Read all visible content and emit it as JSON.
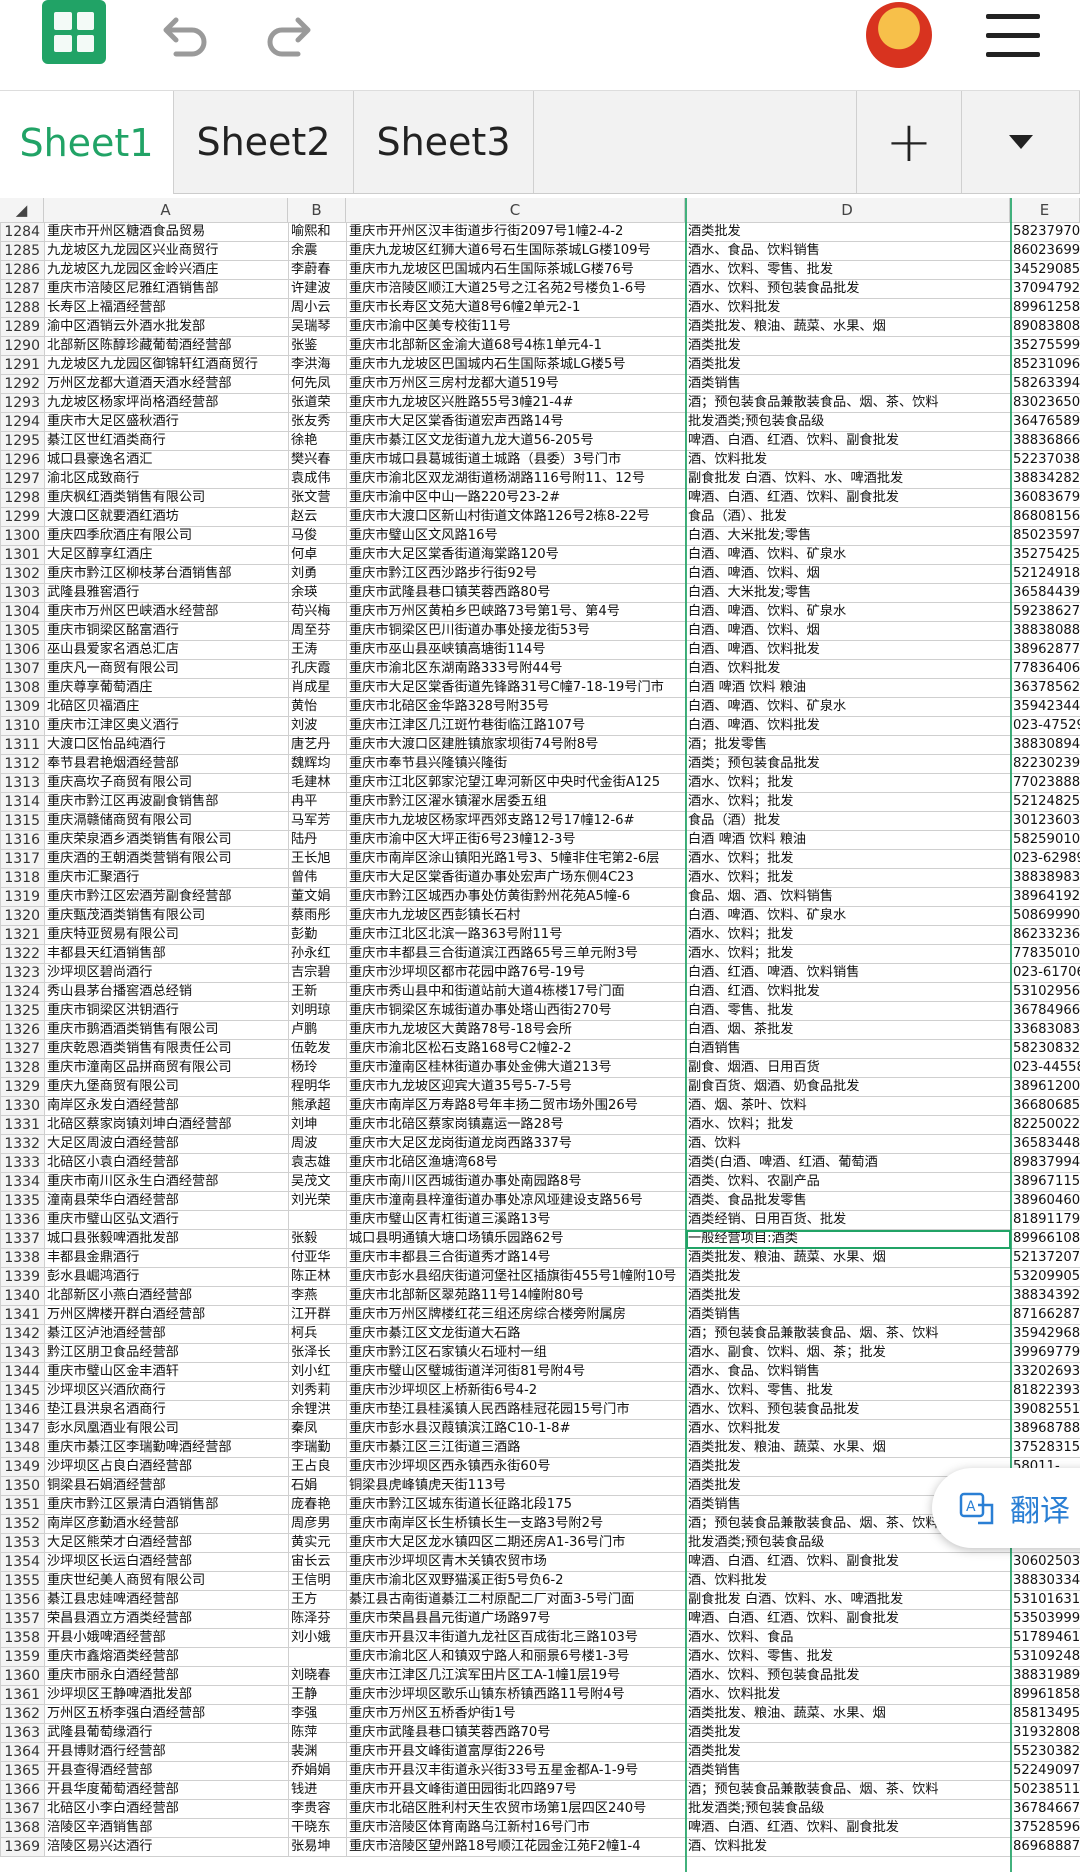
{
  "toolbar": {
    "brand": "#21a366"
  },
  "tabs": [
    {
      "label": "Sheet1",
      "active": true
    },
    {
      "label": "Sheet2"
    },
    {
      "label": "Sheet3"
    }
  ],
  "add_label": "+",
  "columns": [
    "A",
    "B",
    "C",
    "D",
    "E"
  ],
  "translate_label": "翻译",
  "rows": [
    [
      "1284",
      "重庆市开州区糖酒食品贸易",
      "喻熙和",
      "重庆市开州区汉丰街道步行街2097号1幢2-4-2",
      "酒类批发",
      "58237970"
    ],
    [
      "1285",
      "九龙坡区九龙园区兴业商贸行",
      "余震",
      "重庆九龙坡区红狮大道6号石生国际茶城LG楼109号",
      "酒水、食品、饮料销售",
      "86023699"
    ],
    [
      "1286",
      "九龙坡区九龙园区金岭兴酒庄",
      "李蔚春",
      "重庆市九龙坡区巴国城内石生国际茶城LG楼76号",
      "酒水、饮料、零售、批发",
      "34529085"
    ],
    [
      "1287",
      "重庆市涪陵区尼雅红酒销售部",
      "许建波",
      "重庆市涪陵区顺江大道25号之江名苑2号楼负1-6号",
      "酒水、饮料、预包装食品批发",
      "37094792"
    ],
    [
      "1288",
      "长寿区上福酒经营部",
      "周小云",
      "重庆市长寿区文苑大道8号6幢2单元2-1",
      "酒水、饮料批发",
      "89961258"
    ],
    [
      "1289",
      "渝中区酒销云外酒水批发部",
      "吴瑞琴",
      "重庆市渝中区美专校街11号",
      "酒类批发、粮油、蔬菜、水果、烟",
      "89083808"
    ],
    [
      "1290",
      "北部新区陈醇珍藏葡萄酒经营部",
      "张鉴",
      "重庆市北部新区金渝大道68号4栋1单元4-1",
      "酒类批发",
      "35275599"
    ],
    [
      "1291",
      "九龙坡区九龙园区御锦轩红酒商贸行",
      "李洪海",
      "重庆市九龙坡区巴国城内石生国际茶城LG楼5号",
      "酒类批发",
      "85231096"
    ],
    [
      "1292",
      "万州区龙都大道酒天酒水经营部",
      "何先凤",
      "重庆市万州区三房村龙都大道519号",
      "酒类销售",
      "58263394"
    ],
    [
      "1293",
      "九龙坡区杨家坪尚格酒经营部",
      "张道荣",
      "重庆市九龙坡区兴胜路55号3幢21-4#",
      "酒；预包装食品兼散装食品、烟、茶、饮料",
      "83023650"
    ],
    [
      "1294",
      "重庆市大足区盛秋酒行",
      "张友秀",
      "重庆市大足区棠香街道宏声西路14号",
      "批发酒类;预包装食品级",
      "36476589"
    ],
    [
      "1295",
      "綦江区世红酒类商行",
      "徐艳",
      "重庆市綦江区文龙街道九龙大道56-205号",
      "啤酒、白酒、红酒、饮料、副食批发",
      "38836866"
    ],
    [
      "1296",
      "城口县豪逸名酒汇",
      "樊兴春",
      "重庆市城口县葛城街道土城路（县委）3号门市",
      "酒、饮料批发",
      "52237038"
    ],
    [
      "1297",
      "渝北区成致商行",
      "袁成伟",
      "重庆市渝北区双龙湖街道杨湖路116号附11、12号",
      "副食批发 白酒、饮料、水、啤酒批发",
      "38834282"
    ],
    [
      "1298",
      "重庆枫红酒类销售有限公司",
      "张文营",
      "重庆市渝中区中山一路220号23-2#",
      "啤酒、白酒、红酒、饮料、副食批发",
      "36083679"
    ],
    [
      "1299",
      "大渡口区就要酒红酒坊",
      "赵云",
      "重庆市大渡口区新山村街道文体路126号2栋8-22号",
      "食品（酒）、批发",
      "86808156"
    ],
    [
      "1300",
      "重庆四季欣酒庄有限公司",
      "马俊",
      "重庆市璧山区文风路16号",
      "白酒、大米批发;零售",
      "85023597"
    ],
    [
      "1301",
      "大足区醇享红酒庄",
      "何卓",
      "重庆市大足区棠香街道海棠路120号",
      "白酒、啤酒、饮料、矿泉水",
      "35275425"
    ],
    [
      "1302",
      "重庆市黔江区柳枝茅台酒销售部",
      "刘勇",
      "重庆市黔江区西沙路步行街92号",
      "白酒、啤酒、饮料、烟",
      "52124918"
    ],
    [
      "1303",
      "武隆县雅窖酒行",
      "余瑛",
      "重庆市武隆县巷口镇芙蓉西路80号",
      "白酒、大米批发;零售",
      "36584439"
    ],
    [
      "1304",
      "重庆市万州区巴峡酒水经营部",
      "苟兴梅",
      "重庆市万州区黄柏乡巴峡路73号第1号、第4号",
      "白酒、啤酒、饮料、矿泉水",
      "59238627"
    ],
    [
      "1305",
      "重庆市铜梁区酩富酒行",
      "周至芬",
      "重庆市铜梁区巴川街道办事处接龙街53号",
      "白酒、啤酒、饮料、烟",
      "38838088"
    ],
    [
      "1306",
      "巫山县爱家名酒总汇店",
      "王涛",
      "重庆市巫山县巫峡镇高塘街114号",
      "白酒、啤酒、饮料批发",
      "38962877"
    ],
    [
      "1307",
      "重庆凡一商贸有限公司",
      "孔庆霞",
      "重庆市渝北区东湖南路333号附44号",
      "白酒、饮料批发",
      "77836406"
    ],
    [
      "1308",
      "重庆尊享葡萄酒庄",
      "肖成星",
      "重庆市大足区棠香街道先锋路31号C幢7-18-19号门市",
      "白酒 啤酒 饮料 粮油",
      "36378562"
    ],
    [
      "1309",
      "北碚区贝福酒庄",
      "黄怡",
      "重庆市北碚区金华路328号附35号",
      "白酒、啤酒、饮料、矿泉水",
      "35942344"
    ],
    [
      "1310",
      "重庆市江津区奥义酒行",
      "刘波",
      "重庆市江津区几江斑竹巷街临江路107号",
      "白酒、啤酒、饮料批发",
      "023-47529"
    ],
    [
      "1311",
      "大渡口区怡品纯酒行",
      "唐艺丹",
      "重庆市大渡口区建胜镇旅家坝街74号附8号",
      "酒；批发零售",
      "38830894"
    ],
    [
      "1312",
      "奉节县君艳烟酒经营部",
      "魏辉均",
      "重庆市奉节县兴隆镇兴隆街",
      "酒类；预包装食品批发",
      "82230239"
    ],
    [
      "1313",
      "重庆高坎子商贸有限公司",
      "毛建林",
      "重庆市江北区郭家沱望江卑河新区中央时代金街A125",
      "酒水、饮料；批发",
      "77023888"
    ],
    [
      "1314",
      "重庆市黔江区再波副食销售部",
      "冉平",
      "重庆市黔江区濯水镇濯水居委五组",
      "酒水、饮料；批发",
      "52124825"
    ],
    [
      "1315",
      "重庆滆赣储商贸有限公司",
      "马军芳",
      "重庆市九龙坡区杨家坪西郊支路12号17幢12-6#",
      "食品（酒）批发",
      "30123603"
    ],
    [
      "1316",
      "重庆荣泉酒乡酒类销售有限公司",
      "陆丹",
      "重庆市渝中区大坪正街6号23幢12-3号",
      "白酒 啤酒 饮料 粮油",
      "58259010"
    ],
    [
      "1317",
      "重庆酒的王朝酒类营销有限公司",
      "王长旭",
      "重庆市南岸区涂山镇阳光路1号3、5幢非住宅第2-6层",
      "酒水、饮料；批发",
      "023-62989"
    ],
    [
      "1318",
      "重庆市汇聚酒行",
      "曾伟",
      "重庆市大足区棠香街道办事处宏声广场东侧4C23",
      "酒水、饮料；批发",
      "38838983"
    ],
    [
      "1319",
      "重庆市黔江区宏酒芳副食经营部",
      "董文娟",
      "重庆市黔江区城西办事处仿黄街黔州花苑A5幢-6",
      "食品、烟、酒、饮料销售",
      "38964192"
    ],
    [
      "1320",
      "重庆甄茂酒类销售有限公司",
      "蔡雨彤",
      "重庆市九龙坡区西彭镇长石村",
      "白酒、啤酒、饮料、矿泉水",
      "50869990"
    ],
    [
      "1321",
      "重庆特亚贸易有限公司",
      "彭勤",
      "重庆市江北区北滨一路363号附11号",
      "酒水、饮料；批发",
      "86233236"
    ],
    [
      "1322",
      "丰都县天红酒销售部",
      "孙永红",
      "重庆市丰都县三合街道滨江西路65号三单元附3号",
      "酒水、饮料；批发",
      "77835010"
    ],
    [
      "1323",
      "沙坪坝区碧尚酒行",
      "吉宗碧",
      "重庆市沙坪坝区都市花园中路76号-19号",
      "白酒、红酒、啤酒、饮料销售",
      "023-61706"
    ],
    [
      "1324",
      "秀山县茅台播窖酒总经销",
      "王新",
      "重庆市秀山县中和街道站前大道4栋楼17号门面",
      "白酒、红酒、饮料批发",
      "53102956"
    ],
    [
      "1325",
      "重庆市铜梁区洪钥酒行",
      "刘明琼",
      "重庆市铜梁区东城街道办事处塔山西街270号",
      "白酒、零售、批发",
      "36784966"
    ],
    [
      "1326",
      "重庆市鹅酒酒类销售有限公司",
      "卢鹏",
      "重庆市九龙坡区大黄路78号-18号会所",
      "白酒、烟、茶批发",
      "33683083"
    ],
    [
      "1327",
      "重庆乾恩酒类销售有限责任公司",
      "伍乾发",
      "重庆市渝北区松石支路168号C2幢2-2",
      "白酒销售",
      "58230832"
    ],
    [
      "1328",
      "重庆市潼南区品拼商贸有限公司",
      "杨玲",
      "重庆市潼南区桂林街道办事处金佛大道213号",
      "副食、烟酒、日用百货",
      "023-44558"
    ],
    [
      "1329",
      "重庆九堡商贸有限公司",
      "程明华",
      "重庆市九龙坡区迎宾大道35号5-7-5号",
      "副食百货、烟酒、奶食品批发",
      "38961200"
    ],
    [
      "1330",
      "南岸区永发白酒经营部",
      "熊承超",
      "重庆市南岸区万寿路8号年丰扬二贸市场外围26号",
      "酒、烟、茶叶、饮料",
      "36680685"
    ],
    [
      "1331",
      "北碚区蔡家岗镇刘坤白酒经营部",
      "刘坤",
      "重庆市北碚区蔡家岗镇嘉运一路28号",
      "酒水、饮料；批发",
      "82250022"
    ],
    [
      "1332",
      "大足区周波白酒经营部",
      "周波",
      "重庆市大足区龙岗街道龙岗西路337号",
      "酒、饮料",
      "36583448"
    ],
    [
      "1333",
      "北碚区小袁白酒经营部",
      "袁志雄",
      "重庆市北碚区渔塘湾68号",
      "酒类(白酒、啤酒、红酒、葡萄酒",
      "89837994"
    ],
    [
      "1334",
      "重庆市南川区永生白酒经营部",
      "吴茂文",
      "重庆市南川区西城街道办事处南园路8号",
      "酒类、饮料、农副产品",
      "38967115"
    ],
    [
      "1335",
      "潼南县荣华白酒经营部",
      "刘光荣",
      "重庆市潼南县梓潼街道办事处凉风垭建设支路56号",
      "酒类、食品批发零售",
      "38960460"
    ],
    [
      "1336",
      "重庆市璧山区弘文酒行",
      "",
      "重庆市璧山区青杠街道三溪路13号",
      "酒类经销、日用百货、批发",
      "81891179"
    ],
    [
      "1337",
      "城口县张毅啤酒批发部",
      "张毅",
      "城口县明通镇大塘口场镇乐园路62号",
      "一般经营项目:酒类",
      "89966108"
    ],
    [
      "1338",
      "丰都县金鼎酒行",
      "付亚华",
      "重庆市丰都县三合街道秀才路14号",
      "酒类批发、粮油、蔬菜、水果、烟",
      "52137207"
    ],
    [
      "1339",
      "彭水县崛鸿酒行",
      "陈正林",
      "重庆市彭水县绍庆街道河堡社区插旗街455号1幢附10号",
      "酒类批发",
      "53209905"
    ],
    [
      "1340",
      "北部新区小燕白酒经营部",
      "李燕",
      "重庆市北部新区翠苑路11号14幢附80号",
      "酒类批发",
      "38834392"
    ],
    [
      "1341",
      "万州区牌楼开群白酒经营部",
      "江开群",
      "重庆市万州区牌楼红花三组还房综合楼旁附属房",
      "酒类销售",
      "87166287"
    ],
    [
      "1342",
      "綦江区泸池酒经营部",
      "柯兵",
      "重庆市綦江区文龙街道大石路",
      "酒；预包装食品兼散装食品、烟、茶、饮料",
      "35942968"
    ],
    [
      "1343",
      "黔江区朋卫食品经营部",
      "张泽长",
      "重庆市黔江区石家镇火石垭村一组",
      "酒水、副食、饮料、烟、茶；批发",
      "39969779"
    ],
    [
      "1344",
      "重庆市璧山区金丰酒轩",
      "刘小红",
      "重庆市璧山区璧城街道洋河街81号附4号",
      "酒水、食品、饮料销售",
      "33202693"
    ],
    [
      "1345",
      "沙坪坝区兴酒欣商行",
      "刘秀莉",
      "重庆市沙坪坝区上桥新街6号4-2",
      "酒水、饮料、零售、批发",
      "81822393"
    ],
    [
      "1346",
      "垫江县洪泉名酒商行",
      "余锂洪",
      "重庆市垫江县桂溪镇人民西路桂冠花园15号门市",
      "酒水、饮料、预包装食品批发",
      "39082551"
    ],
    [
      "1347",
      "彭水凤凰酒业有限公司",
      "秦凤",
      "重庆市彭水县汉葭镇滨江路C10-1-8#",
      "酒水、饮料批发",
      "38968788"
    ],
    [
      "1348",
      "重庆市綦江区李瑞勤啤酒经营部",
      "李瑞勤",
      "重庆市綦江区三江街道三酒路",
      "酒类批发、粮油、蔬菜、水果、烟",
      "37528315"
    ],
    [
      "1349",
      "沙坪坝区占良白酒经营部",
      "王占良",
      "重庆市沙坪坝区西永镇西永街60号",
      "酒类批发",
      "58011-"
    ],
    [
      "1350",
      "铜梁县石娟酒经营部",
      "石娟",
      "铜梁县虎峰镇虎天街113号",
      "酒类批发",
      "69"
    ],
    [
      "1351",
      "重庆市黔江区景清白酒销售部",
      "庞春艳",
      "重庆市黔江区城东街道长征路北段175",
      "酒类销售",
      ""
    ],
    [
      "1352",
      "南岸区彦勤酒水经营部",
      "周彦男",
      "重庆市南岸区长生桥镇长生一支路3号附2号",
      "酒；预包装食品兼散装食品、烟、茶、饮料",
      ""
    ],
    [
      "1353",
      "大足区熊荣才白酒经营部",
      "黄实元",
      "重庆市大足区龙水镇四区二期还房A1-36号门市",
      "批发酒类;预包装食品级",
      ""
    ],
    [
      "1354",
      "沙坪坝区长运白酒经营部",
      "宙长云",
      "重庆市沙坪坝区青木关镇农贸市场",
      "啤酒、白酒、红酒、饮料、副食批发",
      "30602503"
    ],
    [
      "1355",
      "重庆世纪美人商贸有限公司",
      "王信明",
      "重庆市渝北区双野猫溪正街5号负6-2",
      "酒、饮料批发",
      "38830334"
    ],
    [
      "1356",
      "綦江县忠娃啤酒经营部",
      "王方",
      "綦江县古南街道綦江二村原配二厂对面3-5号门面",
      "副食批发 白酒、饮料、水、啤酒批发",
      "53101631"
    ],
    [
      "1357",
      "荣昌县酒立方酒类经营部",
      "陈泽芬",
      "重庆市荣昌县昌元街道广场路97号",
      "啤酒、白酒、红酒、饮料、副食批发",
      "53503999"
    ],
    [
      "1358",
      "开县小娥啤酒经营部",
      "刘小娥",
      "重庆市开县汉丰街道九龙社区百成街北三路103号",
      "酒水、饮料、食品",
      "51789461"
    ],
    [
      "1359",
      "重庆市鑫熔酒类经营部",
      "",
      "重庆市渝北区人和镇双宁路人和丽景6号楼1-3号",
      "酒水、饮料、零售、批发",
      "53109248"
    ],
    [
      "1360",
      "重庆市丽永白酒经营部",
      "刘晓春",
      "重庆市江津区几江滨军田片区工A-1幢1层19号",
      "酒水、饮料、预包装食品批发",
      "38831989"
    ],
    [
      "1361",
      "沙坪坝区王静啤酒批发部",
      "王静",
      "重庆市沙坪坝区歌乐山镇东桥镇西路11号附4号",
      "酒水、饮料批发",
      "89961858"
    ],
    [
      "1362",
      "万州区五桥李强白酒经营部",
      "李强",
      "重庆市万州区五桥香炉街1号",
      "酒类批发、粮油、蔬菜、水果、烟",
      "85813495"
    ],
    [
      "1363",
      "武隆县葡萄缘酒行",
      "陈萍",
      "重庆市武隆县巷口镇芙蓉西路70号",
      "酒类批发",
      "31932808"
    ],
    [
      "1364",
      "开县博财酒行经营部",
      "裴渊",
      "重庆市开县文峰街道富厚街226号",
      "酒类批发",
      "55230382"
    ],
    [
      "1365",
      "开县查得酒经营部",
      "乔娟娟",
      "重庆市开县汉丰街道永兴街33号五星金都A-1-9号",
      "酒类销售",
      "52249097"
    ],
    [
      "1366",
      "开县华度葡萄酒经营部",
      "钱进",
      "重庆市开县文峰街道田园街北四路97号",
      "酒；预包装食品兼散装食品、烟、茶、饮料",
      "50238511"
    ],
    [
      "1367",
      "北碚区小李白酒经营部",
      "李贵容",
      "重庆市北碚区胜利村天生农贸市场第1层四区240号",
      "批发酒类;预包装食品级",
      "36784667"
    ],
    [
      "1368",
      "涪陵区辛酒销售部",
      "干晓东",
      "重庆市涪陵区体育南路乌江新村16号门市",
      "啤酒、白酒、红酒、饮料、副食批发",
      "37528596"
    ],
    [
      "1369",
      "涪陵区易兴达酒行",
      "张易坤",
      "重庆市涪陵区望州路18号顺江花园金江苑F2幢1-4",
      "酒、饮料批发",
      "86968887"
    ]
  ]
}
